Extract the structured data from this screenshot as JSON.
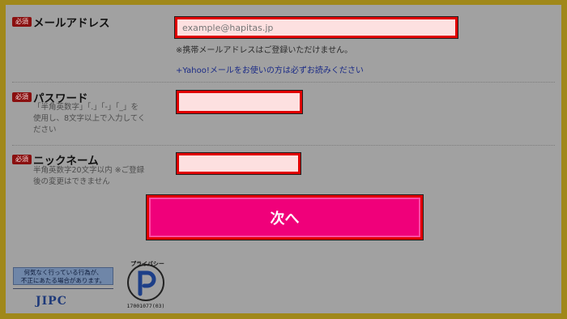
{
  "form": {
    "required_badge": "必須",
    "email": {
      "label": "メールアドレス",
      "placeholder": "example@hapitas.jp",
      "note": "※携帯メールアドレスはご登録いただけません。",
      "link": "+Yahoo!メールをお使いの方は必ずお読みください"
    },
    "password": {
      "label": "パスワード",
      "hint_line1": "「半角英数字」「.」「-」「_」を",
      "hint_line2": "使用し、8文字以上で入力してく",
      "hint_line3": "ださい",
      "value": ""
    },
    "nickname": {
      "label": "ニックネーム",
      "hint_line1": "半角英数字20文字以内 ※ご登録",
      "hint_line2": "後の変更はできません",
      "value": ""
    },
    "submit_label": "次へ"
  },
  "footer": {
    "jipc_notice_line1": "何気なく行っている行為が、",
    "jipc_notice_line2": "不正にあたる場合があります。",
    "jipc_logo": "JIPC",
    "privacy_mark_text": "プライバシー",
    "privacy_mark_number": "17001077(03)"
  },
  "colors": {
    "frame": "#a0881a",
    "panel": "#a1a1a1",
    "required": "#8a1010",
    "input_bg": "#fde0e0",
    "highlight": "#e00000",
    "submit": "#f0007a",
    "link": "#1a2a86"
  }
}
